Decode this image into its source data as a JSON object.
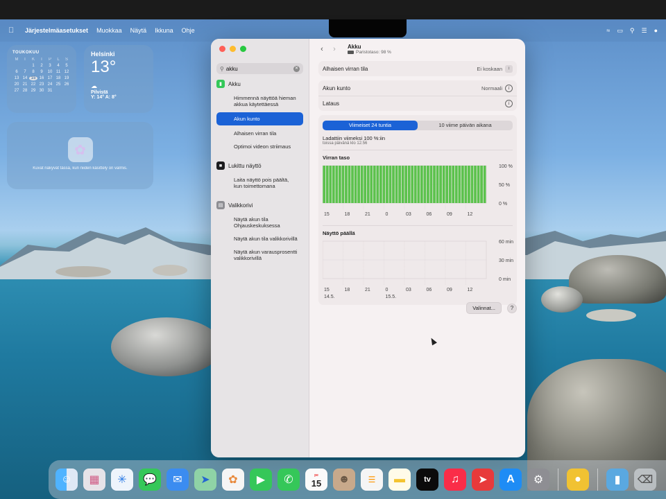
{
  "menubar": {
    "app_name": "Järjestelmäasetukset",
    "menus": [
      "Muokkaa",
      "Näytä",
      "Ikkuna",
      "Ohje"
    ]
  },
  "widgets": {
    "calendar": {
      "month": "TOUKOKUU",
      "weekdays": [
        "M",
        "T",
        "K",
        "T",
        "P",
        "L",
        "S"
      ],
      "days": [
        "",
        "",
        "1",
        "2",
        "3",
        "4",
        "5",
        "6",
        "7",
        "8",
        "9",
        "10",
        "11",
        "12",
        "13",
        "14",
        "15",
        "16",
        "17",
        "18",
        "19",
        "20",
        "21",
        "22",
        "23",
        "24",
        "25",
        "26",
        "27",
        "28",
        "29",
        "30",
        "31",
        "",
        ""
      ],
      "today": "15"
    },
    "weather": {
      "city": "Helsinki",
      "temp": "13°",
      "condition": "Pilvistä",
      "hilo": "Y: 14° A: 8°"
    },
    "photos": {
      "message": "Kuvat näkyvät tässä, kun niiden käsittely on valmis."
    }
  },
  "sidebar": {
    "search_value": "akku",
    "sections": [
      {
        "title": "Akku",
        "icon": "battery-icon",
        "items": [
          {
            "label": "Himmennä näyttöä hieman akkua käytettäessä",
            "selected": false
          },
          {
            "label": "Akun kunto",
            "selected": true
          },
          {
            "label": "Alhaisen virran tila",
            "selected": false
          },
          {
            "label": "Optimoi videon striimaus",
            "selected": false
          }
        ]
      },
      {
        "title": "Lukittu näyttö",
        "icon": "lock-screen-icon",
        "items": [
          {
            "label": "Laita näyttö pois päältä, kun toimettomana",
            "selected": false
          }
        ]
      },
      {
        "title": "Valikkorivi",
        "icon": "menubar-icon",
        "items": [
          {
            "label": "Näytä akun tila Ohjauskeskuksessa",
            "selected": false
          },
          {
            "label": "Näytä akun tila valikkorivillä",
            "selected": false
          },
          {
            "label": "Näytä akun varausprosentti valikkorivillä",
            "selected": false
          }
        ]
      }
    ]
  },
  "main": {
    "title": "Akku",
    "subtitle": "Paristotaso: 98 %",
    "low_power": {
      "label": "Alhaisen virran tila",
      "value": "Ei koskaan"
    },
    "health": {
      "label": "Akun kunto",
      "value": "Normaali"
    },
    "charging": {
      "label": "Lataus"
    },
    "tabs": [
      "Viimeiset 24 tuntia",
      "10 viime päivän aikana"
    ],
    "active_tab": 0,
    "last_charged": "Ladattiin viimeksi 100 %:iin",
    "last_charged_time": "toissa päivänä klo 12.56",
    "options_button": "Valinnat...",
    "help_button": "?"
  },
  "chart_data": [
    {
      "type": "bar",
      "title": "Virran taso",
      "x_ticks": [
        "15",
        "18",
        "21",
        "0",
        "03",
        "06",
        "09",
        "12"
      ],
      "y_ticks": [
        "100 %",
        "50 %",
        "0 %"
      ],
      "ylim": [
        0,
        100
      ],
      "bar_count": 52,
      "values": [
        100,
        100,
        100,
        100,
        100,
        100,
        100,
        100,
        100,
        100,
        100,
        100,
        100,
        100,
        100,
        100,
        100,
        100,
        100,
        100,
        100,
        100,
        100,
        100,
        100,
        100,
        100,
        100,
        100,
        100,
        100,
        100,
        100,
        100,
        100,
        100,
        100,
        100,
        100,
        100,
        100,
        100,
        100,
        100,
        100,
        100,
        100,
        100,
        100,
        100,
        100,
        100
      ],
      "color": "#5cc24d"
    },
    {
      "type": "bar",
      "title": "Näyttö päällä",
      "x_ticks": [
        "15",
        "18",
        "21",
        "0",
        "03",
        "06",
        "09",
        "12"
      ],
      "x_dates": [
        "14.5.",
        "15.5."
      ],
      "y_ticks": [
        "60 min",
        "30 min",
        "0 min"
      ],
      "ylim": [
        0,
        60
      ],
      "values": []
    }
  ],
  "dock": {
    "calendar_day": "15",
    "calendar_month": "pe",
    "tv_label": "tv",
    "apps": [
      "Finder",
      "Launchpad",
      "Safari",
      "Viestit",
      "Mail",
      "Kartat",
      "Kuvat",
      "FaceTime",
      "Puhelin",
      "Kalenteri",
      "Yhteystiedot",
      "Muistutukset",
      "Muistiinpanot",
      "TV",
      "Musiikki",
      "RocketSim",
      "App Store",
      "Järjestelmäasetukset",
      "Vinkit",
      "Kansio",
      "Roskakori"
    ]
  }
}
